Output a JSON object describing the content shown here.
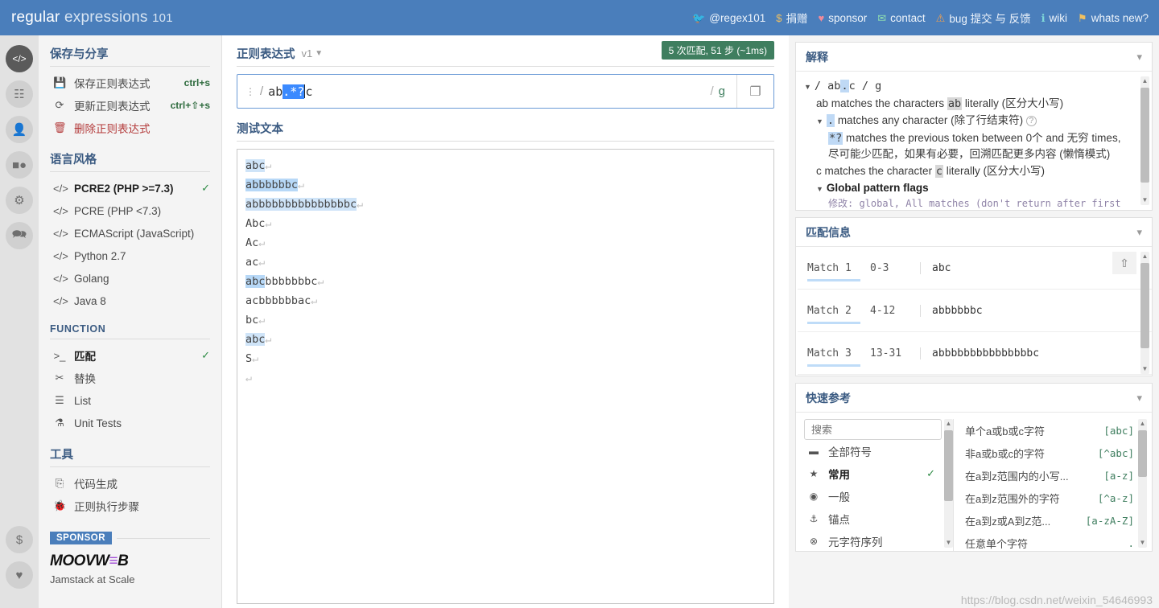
{
  "header": {
    "logo_strong": "regular",
    "logo_light": "expressions",
    "logo_num": "101",
    "nav": [
      {
        "icon": "twitter-icon",
        "glyph": "🐦",
        "label": "@regex101",
        "color": "#5aa9e6"
      },
      {
        "icon": "dollar-icon",
        "glyph": "$",
        "label": "捐赠",
        "color": "#f0c060"
      },
      {
        "icon": "heart-icon",
        "glyph": "♥",
        "label": "sponsor",
        "color": "#f08a9a"
      },
      {
        "icon": "mail-icon",
        "glyph": "✉",
        "label": "contact",
        "color": "#8fe0b0"
      },
      {
        "icon": "warning-icon",
        "glyph": "⚠",
        "label": "bug 提交 与 反馈",
        "color": "#f0a050"
      },
      {
        "icon": "wiki-icon",
        "glyph": "ℹ",
        "label": "wiki",
        "color": "#7fd8d8"
      },
      {
        "icon": "news-icon",
        "glyph": "⚑",
        "label": "whats new?",
        "color": "#f0c060"
      }
    ]
  },
  "rail": {
    "items": [
      {
        "name": "code-icon",
        "glyph": "</>",
        "active": true
      },
      {
        "name": "library-icon",
        "glyph": "☷",
        "active": false
      },
      {
        "name": "account-icon",
        "glyph": "👤",
        "active": false
      },
      {
        "name": "gamepad-icon",
        "glyph": "■●",
        "active": false
      },
      {
        "name": "settings-gear-icon",
        "glyph": "⚙",
        "active": false
      },
      {
        "name": "chat-icon",
        "glyph": "🗪",
        "active": false
      }
    ],
    "bottom": [
      {
        "name": "donate-dollar-icon",
        "glyph": "$"
      },
      {
        "name": "sponsor-heart-icon",
        "glyph": "♥"
      }
    ]
  },
  "sidebar": {
    "save_share": {
      "title": "保存与分享",
      "items": [
        {
          "icon": "save-icon",
          "glyph": "💾",
          "label": "保存正则表达式",
          "shortcut": "ctrl+s",
          "danger": false
        },
        {
          "icon": "refresh-icon",
          "glyph": "⟳",
          "label": "更新正则表达式",
          "shortcut": "ctrl+⇧+s",
          "danger": false
        },
        {
          "icon": "trash-icon",
          "glyph": "🗑",
          "label": "删除正则表达式",
          "shortcut": "",
          "danger": true
        }
      ]
    },
    "flavors": {
      "title": "语言风格",
      "items": [
        {
          "label": "PCRE2 (PHP >=7.3)",
          "selected": true
        },
        {
          "label": "PCRE (PHP <7.3)",
          "selected": false
        },
        {
          "label": "ECMAScript (JavaScript)",
          "selected": false
        },
        {
          "label": "Python 2.7",
          "selected": false
        },
        {
          "label": "Golang",
          "selected": false
        },
        {
          "label": "Java 8",
          "selected": false
        }
      ]
    },
    "function": {
      "title": "FUNCTION",
      "items": [
        {
          "icon": "terminal-icon",
          "glyph": ">_",
          "label": "匹配",
          "selected": true
        },
        {
          "icon": "scissors-icon",
          "glyph": "✂",
          "label": "替换",
          "selected": false
        },
        {
          "icon": "list-icon",
          "glyph": "☰",
          "label": "List",
          "selected": false
        },
        {
          "icon": "flask-icon",
          "glyph": "⚗",
          "label": "Unit Tests",
          "selected": false
        }
      ]
    },
    "tools": {
      "title": "工具",
      "items": [
        {
          "icon": "code-file-icon",
          "glyph": "⎘",
          "label": "代码生成"
        },
        {
          "icon": "debug-bug-icon",
          "glyph": "🐞",
          "label": "正则执行步骤"
        }
      ]
    },
    "sponsor": {
      "badge": "SPONSOR",
      "logo_pre": "MOOVW",
      "logo_e": "≡",
      "logo_post": "B",
      "tagline": "Jamstack at Scale"
    }
  },
  "regex_panel": {
    "title": "正则表达式",
    "version": "v1",
    "match_badge": "5 次匹配, 51 步 (~1ms)",
    "delimiter": "/",
    "pattern_pre": "ab",
    "pattern_selected": ".*?",
    "pattern_post": "c",
    "flags": "g",
    "flag_slash": "/",
    "copy_icon": "❐"
  },
  "test_panel": {
    "title": "测试文本",
    "lines": [
      {
        "segments": [
          {
            "t": "abc",
            "hl": "hl1"
          }
        ],
        "eol": true
      },
      {
        "segments": [
          {
            "t": "abbbbbbc",
            "hl": "hl2"
          }
        ],
        "eol": true
      },
      {
        "segments": [
          {
            "t": "abbbbbbbbbbbbbbbc",
            "hl": "hl1"
          }
        ],
        "eol": true
      },
      {
        "segments": [
          {
            "t": "Abc",
            "hl": ""
          }
        ],
        "eol": true
      },
      {
        "segments": [
          {
            "t": "Ac",
            "hl": ""
          }
        ],
        "eol": true
      },
      {
        "segments": [
          {
            "t": "ac",
            "hl": ""
          }
        ],
        "eol": true
      },
      {
        "segments": [
          {
            "t": "abc",
            "hl": "hl2"
          },
          {
            "t": "bbbbbbbc",
            "hl": ""
          }
        ],
        "eol": true
      },
      {
        "segments": [
          {
            "t": "acbbbbbbac",
            "hl": ""
          }
        ],
        "eol": true
      },
      {
        "segments": [
          {
            "t": "bc",
            "hl": ""
          }
        ],
        "eol": true
      },
      {
        "segments": [
          {
            "t": "abc",
            "hl": "hl1"
          }
        ],
        "eol": true
      },
      {
        "segments": [
          {
            "t": "S",
            "hl": ""
          }
        ],
        "eol": true
      },
      {
        "segments": [
          {
            "t": "",
            "hl": ""
          }
        ],
        "eol": true
      }
    ]
  },
  "explanation": {
    "title": "解释",
    "header_pre": "/ ab",
    "header_tok": ".",
    "header_post": "c / g",
    "line_ab_pre": "ab matches the characters ",
    "line_ab_tok": "ab",
    "line_ab_post": " literally (区分大小写)",
    "line_dot_tok": ".",
    "line_dot_post": " matches any character (除了行结束符)",
    "line_star_tok": "*?",
    "line_star_post": " matches the previous token between 0个 and 无穷 times, 尽可能少匹配，如果有必要，回溯匹配更多内容 (懒惰模式)",
    "line_c_pre": "c matches the character ",
    "line_c_tok": "c",
    "line_c_post": " literally (区分大小写)",
    "global_flags": "Global pattern flags",
    "cut_line": "修改: global, All matches (don't return after first"
  },
  "match_info": {
    "title": "匹配信息",
    "share_icon": "⇧",
    "matches": [
      {
        "name": "Match 1",
        "range": "0-3",
        "value": "abc"
      },
      {
        "name": "Match 2",
        "range": "4-12",
        "value": "abbbbbbc"
      },
      {
        "name": "Match 3",
        "range": "13-31",
        "value": "abbbbbbbbbbbbbbbc"
      }
    ]
  },
  "quick_reference": {
    "title": "快速参考",
    "search_placeholder": "搜索",
    "search_value": "",
    "categories": [
      {
        "icon": "all-tokens-icon",
        "glyph": "▬",
        "label": "全部符号",
        "selected": false
      },
      {
        "icon": "star-icon",
        "glyph": "★",
        "label": "常用",
        "selected": true
      },
      {
        "icon": "general-icon",
        "glyph": "◉",
        "label": "一般",
        "selected": false
      },
      {
        "icon": "anchor-icon",
        "glyph": "⚓",
        "label": "锚点",
        "selected": false
      },
      {
        "icon": "meta-icon",
        "glyph": "⊗",
        "label": "元字符序列",
        "selected": false
      }
    ],
    "entries": [
      {
        "desc": "单个a或b或c字符",
        "code": "[abc]"
      },
      {
        "desc": "非a或b或c的字符",
        "code": "[^abc]"
      },
      {
        "desc": "在a到z范围内的小写...",
        "code": "[a-z]"
      },
      {
        "desc": "在a到z范围外的字符",
        "code": "[^a-z]"
      },
      {
        "desc": "在a到z或A到Z范...",
        "code": "[a-zA-Z]"
      },
      {
        "desc": "任意单个字符",
        "code": "."
      }
    ]
  },
  "watermark": "https://blog.csdn.net/weixin_54646993"
}
